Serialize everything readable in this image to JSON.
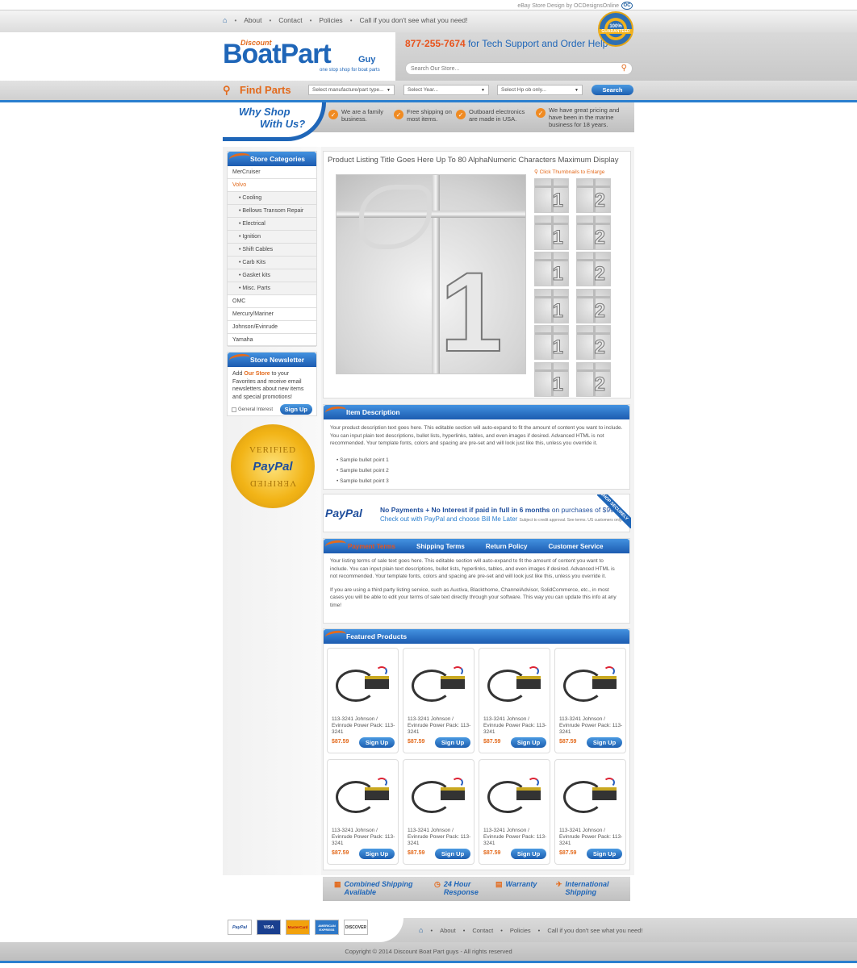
{
  "header": {
    "credit": "eBay Store Design by OCDesignsOnline",
    "credit_logo": "OC",
    "nav": [
      "About",
      "Contact",
      "Policies",
      "Call if you don't see what you need!"
    ],
    "logo": {
      "discount": "Discount",
      "main": "BoatPart",
      "guy": "Guy",
      "tagline": "one stop shop for boat parts"
    },
    "phone": "877-255-7674",
    "phone_text": "for Tech Support and Order Help",
    "search_placeholder": "Search Our Store...",
    "badge": {
      "pct": "100%",
      "label": "GUARANTEED"
    }
  },
  "finder": {
    "label": "Find Parts",
    "selects": [
      "Select manufacture/part type...",
      "Select Year...",
      "Select Hp ob only..."
    ],
    "button": "Search"
  },
  "why": {
    "title_line1": "Why Shop",
    "title_line2": "With Us?",
    "items": [
      "We are a family business.",
      "Free shipping on most items.",
      "Outboard electronics are made in USA.",
      "We have great pricing and have been in the marine business for 18 years."
    ]
  },
  "sidebar": {
    "categories_title": "Store Categories",
    "categories": [
      {
        "label": "MerCruiser",
        "sub": false,
        "active": false
      },
      {
        "label": "Volvo",
        "sub": false,
        "active": true
      },
      {
        "label": "• Cooling",
        "sub": true,
        "active": false
      },
      {
        "label": "• Bellows Transom Repair",
        "sub": true,
        "active": false
      },
      {
        "label": "• Electrical",
        "sub": true,
        "active": false
      },
      {
        "label": "• Ignition",
        "sub": true,
        "active": false
      },
      {
        "label": "• Shift Cables",
        "sub": true,
        "active": false
      },
      {
        "label": "• Carb Kits",
        "sub": true,
        "active": false
      },
      {
        "label": "• Gasket kits",
        "sub": true,
        "active": false
      },
      {
        "label": "• Misc. Parts",
        "sub": true,
        "active": false
      },
      {
        "label": "OMC",
        "sub": false,
        "active": false
      },
      {
        "label": "Mercury/Mariner",
        "sub": false,
        "active": false
      },
      {
        "label": "Johnson/Evinrude",
        "sub": false,
        "active": false
      },
      {
        "label": "Yamaha",
        "sub": false,
        "active": false
      }
    ],
    "newsletter_title": "Store Newsletter",
    "newsletter_pre": "Add ",
    "newsletter_link": "Our Store",
    "newsletter_post": " to your Favorites and receive email newsletters about new items and special promotions!",
    "newsletter_checkbox": "General Interest",
    "newsletter_button": "Sign Up",
    "paypal_seal": {
      "top": "VERIFIED",
      "brand": "PayPal",
      "bottom": "VERIFIED"
    }
  },
  "product": {
    "title": "Product Listing Title Goes Here Up To 80 AlphaNumeric Characters Maximum Display",
    "thumb_hint": "Click Thumbnails to Enlarge",
    "main_number": "1",
    "thumbs": [
      "1",
      "2",
      "1",
      "2",
      "1",
      "2",
      "1",
      "2",
      "1",
      "2",
      "1",
      "2"
    ]
  },
  "description": {
    "title": "Item Description",
    "text": "Your product description text goes here. This editable section will auto-expand to fit the amount of content you want to include. You can input plain text descriptions, bullet lists, hyperlinks, tables, and even images if desired. Advanced HTML is not recommended. Your template fonts, colors and spacing are pre-set and will look just like this, unless you override it.",
    "bullets": [
      "Sample bullet point 1",
      "Sample bullet point 2",
      "Sample bullet point 3"
    ]
  },
  "paypal_banner": {
    "logo": "PayPal",
    "line1_bold": "No Payments + No Interest if paid in full in 6 months",
    "line1_rest": " on purchases of $99+",
    "line2": "Check out with PayPal and choose Bill Me Later",
    "line2_small": "Subject to credit approval. See terms. US customers only.",
    "corner": "SHOP SECURELY"
  },
  "terms": {
    "tabs": [
      "Payment Terms",
      "Shipping Terms",
      "Return Policy",
      "Customer Service"
    ],
    "para1": "Your listing terms of sale text goes here. This editable section will auto-expand to fit the amount of content you want to include. You can input plain text descriptions, bullet lists, hyperlinks, tables, and even images if desired. Advanced HTML is not recommended. Your template fonts, colors and spacing are pre-set and will look just like this, unless you override it.",
    "para2": "If you are using a third party listing service, such as Auctiva, Blackthorne, ChannelAdvisor, SolidCommerce, etc., in most cases you will be able to edit your terms of sale text directly through your software. This way you can update this info at any time!"
  },
  "featured": {
    "title": "Featured Products",
    "products": [
      {
        "title": "113-3241 Johnson / Evinrude Power Pack: 113-3241",
        "price": "$87.59",
        "button": "Sign Up"
      },
      {
        "title": "113-3241 Johnson / Evinrude Power Pack: 113-3241",
        "price": "$87.59",
        "button": "Sign Up"
      },
      {
        "title": "113-3241 Johnson / Evinrude Power Pack: 113-3241",
        "price": "$87.59",
        "button": "Sign Up"
      },
      {
        "title": "113-3241 Johnson / Evinrude Power Pack: 113-3241",
        "price": "$87.59",
        "button": "Sign Up"
      },
      {
        "title": "113-3241 Johnson / Evinrude Power Pack: 113-3241",
        "price": "$87.59",
        "button": "Sign Up"
      },
      {
        "title": "113-3241 Johnson / Evinrude Power Pack: 113-3241",
        "price": "$87.59",
        "button": "Sign Up"
      },
      {
        "title": "113-3241 Johnson / Evinrude Power Pack: 113-3241",
        "price": "$87.59",
        "button": "Sign Up"
      },
      {
        "title": "113-3241 Johnson / Evinrude Power Pack: 113-3241",
        "price": "$87.59",
        "button": "Sign Up"
      }
    ]
  },
  "features": [
    {
      "line1": "Combined Shipping",
      "line2": "Available",
      "icon": "boxes-icon"
    },
    {
      "line1": "24 Hour",
      "line2": "Response",
      "icon": "clock-icon"
    },
    {
      "line1": "Warranty",
      "line2": "",
      "icon": "document-icon"
    },
    {
      "line1": "International",
      "line2": "Shipping",
      "icon": "plane-icon"
    }
  ],
  "footer": {
    "cards": [
      "PayPal",
      "VISA",
      "MasterCard",
      "AMERICAN EXPRESS",
      "DISCOVER"
    ],
    "nav": [
      "About",
      "Contact",
      "Policies",
      "Call if you don't see what you need!"
    ],
    "copyright": "Copyright © 2014 Discount Boat Part guys - All rights reserved"
  },
  "colors": {
    "accent": "#e36a1c",
    "brand_blue": "#1f66b8",
    "bar_blue": "#2a7fcf"
  }
}
